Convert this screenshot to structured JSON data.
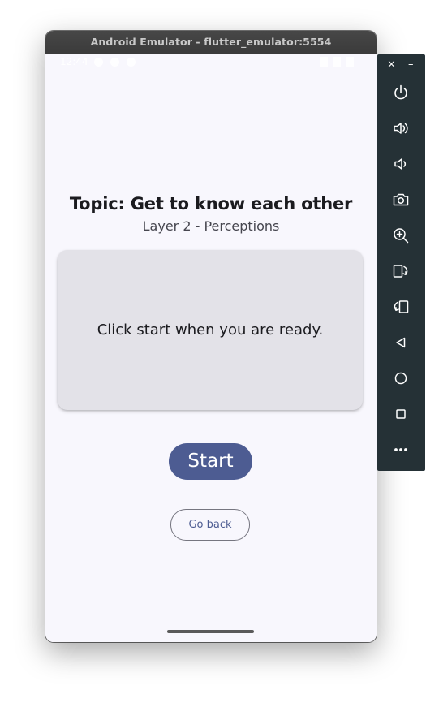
{
  "window": {
    "title": "Android Emulator - flutter_emulator:5554"
  },
  "status_bar": {
    "time": "12:44"
  },
  "screen": {
    "topic_title": "Topic: Get to know each other",
    "layer_subtitle": "Layer 2 - Perceptions",
    "card_text": "Click start when you are ready.",
    "start_label": "Start",
    "go_back_label": "Go back"
  },
  "toolbar": {
    "close_label": "×",
    "minimize_label": "–",
    "buttons": [
      {
        "icon": "power-icon"
      },
      {
        "icon": "volume-up-icon"
      },
      {
        "icon": "volume-down-icon"
      },
      {
        "icon": "camera-icon"
      },
      {
        "icon": "zoom-icon"
      },
      {
        "icon": "rotate-right-icon"
      },
      {
        "icon": "rotate-left-icon"
      },
      {
        "icon": "back-icon"
      },
      {
        "icon": "home-icon"
      },
      {
        "icon": "overview-icon"
      },
      {
        "icon": "more-icon"
      }
    ]
  },
  "colors": {
    "primary": "#4d5c92",
    "background": "#f8f7fd",
    "card": "#e3e2e8",
    "toolbar": "#253136",
    "titlebar": "#3f3f3f"
  }
}
